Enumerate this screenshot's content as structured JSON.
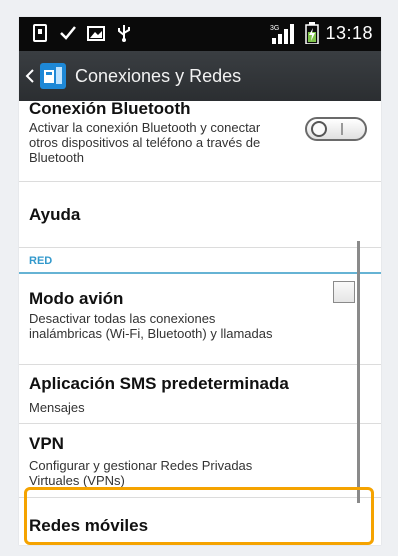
{
  "status_bar": {
    "network_type": "3G",
    "time": "13:18",
    "icons": [
      "notification-icon",
      "check-icon",
      "screenshot-icon",
      "usb-icon",
      "signal-icon",
      "battery-charging-icon"
    ]
  },
  "action_bar": {
    "title": "Conexiones y Redes",
    "back_icon": "chevron-left-icon",
    "app_icon": "settings-app-icon"
  },
  "items": {
    "bluetooth": {
      "title": "Conexión Bluetooth",
      "subtitle": "Activar la conexión Bluetooth y conectar otros dispositivos al teléfono a través de Bluetooth",
      "toggle_state": "off"
    },
    "ayuda": {
      "title": "Ayuda"
    },
    "section_red": {
      "label": "RED"
    },
    "modo_avion": {
      "title": "Modo avión",
      "subtitle": "Desactivar todas las conexiones inalámbricas (Wi-Fi, Bluetooth) y llamadas",
      "checked": false
    },
    "sms": {
      "title": "Aplicación SMS predeterminada",
      "subtitle": "Mensajes"
    },
    "vpn": {
      "title": "VPN",
      "subtitle": "Configurar y gestionar Redes Privadas Virtuales (VPNs)"
    },
    "redes_moviles": {
      "title": "Redes móviles"
    }
  },
  "colors": {
    "accent": "#3399cc",
    "highlight": "#f5a300",
    "action_bar": "#2b2e31"
  }
}
